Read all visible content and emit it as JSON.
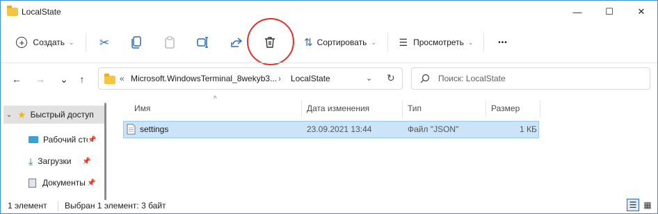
{
  "window": {
    "title": "LocalState",
    "controls": {
      "minimize": "—",
      "maximize": "☐",
      "close": "✕"
    }
  },
  "toolbar": {
    "create_label": "Создать",
    "sort_label": "Сортировать",
    "view_label": "Просмотреть",
    "more_label": "•••",
    "icons": [
      "plus-circle-icon",
      "cut-icon",
      "copy-icon",
      "paste-icon",
      "rename-icon",
      "share-icon",
      "delete-icon",
      "sort-icon",
      "view-icon",
      "more-icon"
    ]
  },
  "nav": {
    "back": "←",
    "forward": "→",
    "up": "↑"
  },
  "address": {
    "overflow": "«",
    "segments": [
      "Microsoft.WindowsTerminal_8wekyb3...",
      "LocalState"
    ],
    "separator": "›",
    "dropdown": "⌄",
    "refresh": "↻"
  },
  "search": {
    "placeholder": "Поиск: LocalState"
  },
  "sidebar": {
    "items": [
      {
        "label": "Быстрый доступ",
        "icon": "star-icon",
        "expander": "⌄",
        "pinned": false
      },
      {
        "label": "Рабочий стол",
        "icon": "desktop-icon",
        "pinned": true
      },
      {
        "label": "Загрузки",
        "icon": "download-icon",
        "pinned": true
      },
      {
        "label": "Документы",
        "icon": "documents-icon",
        "pinned": true
      }
    ],
    "pin_glyph": "📌"
  },
  "columns": {
    "name": "Имя",
    "date": "Дата изменения",
    "type": "Тип",
    "size": "Размер",
    "sort_indicator": "^"
  },
  "files": [
    {
      "name": "settings",
      "date": "23.09.2021 13:44",
      "type": "Файл \"JSON\"",
      "size": "1 КБ",
      "selected": true
    }
  ],
  "status": {
    "count": "1 элемент",
    "selection": "Выбран 1 элемент: 3 байт"
  },
  "colors": {
    "accent": "#2b6cb5",
    "selection": "#cce4f7",
    "highlight_circle": "#e0302a",
    "folder": "#f5c542"
  }
}
